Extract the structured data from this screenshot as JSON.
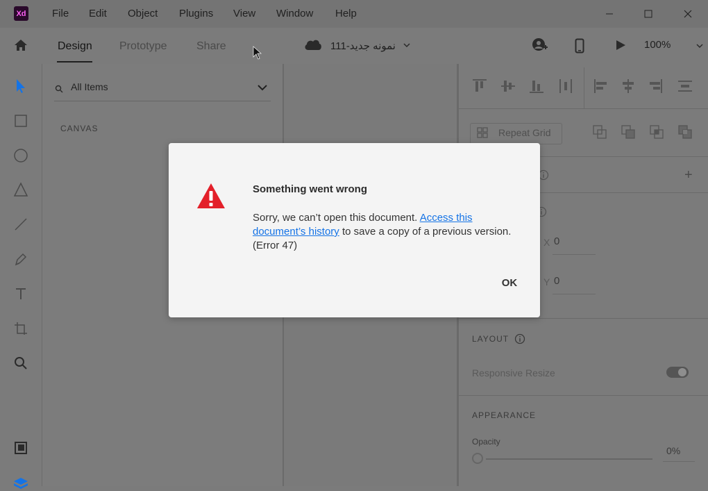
{
  "app": {
    "logo_text": "Xd"
  },
  "menu": [
    "File",
    "Edit",
    "Object",
    "Plugins",
    "View",
    "Window",
    "Help"
  ],
  "window_controls": {
    "minimize": "—",
    "maximize": "☐",
    "close": "✕"
  },
  "tabs": {
    "design": "Design",
    "prototype": "Prototype",
    "share": "Share"
  },
  "document": {
    "title": "نمونه جدید-111"
  },
  "zoom": {
    "value": "100%"
  },
  "layers": {
    "search_placeholder": "All Items",
    "canvas_label": "CANVAS"
  },
  "props": {
    "repeat_grid": "Repeat Grid",
    "x_label": "X",
    "x_value": "0",
    "y_label": "Y",
    "y_value": "0",
    "layout_label": "LAYOUT",
    "responsive_resize": "Responsive Resize",
    "appearance_label": "APPEARANCE",
    "opacity_label": "Opacity",
    "opacity_value": "0%",
    "plus": "+"
  },
  "dialog": {
    "title": "Something went wrong",
    "msg_before": "Sorry, we can’t open this document. ",
    "link_text": "Access this document’s history",
    "msg_after": " to save a copy of a previous version. (Error 47)",
    "ok_label": "OK"
  },
  "colors": {
    "accent": "#1473e6",
    "warning": "#e3202a",
    "xd_logo_bg": "#2a0a2b",
    "xd_logo_text": "#ff61f6"
  }
}
